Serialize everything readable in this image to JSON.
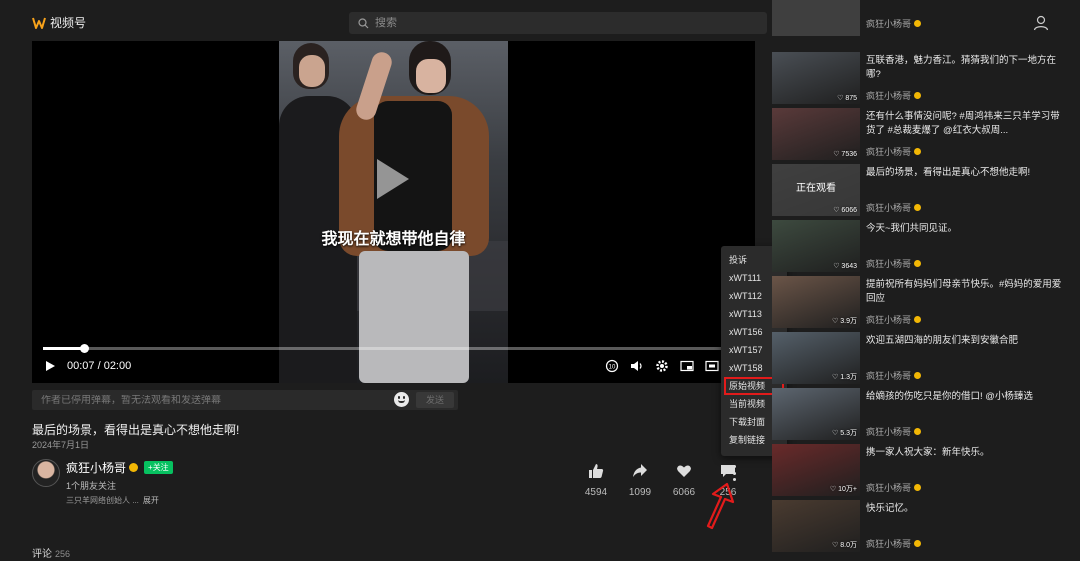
{
  "header": {
    "logo_text": "视频号",
    "search_placeholder": "搜索"
  },
  "player": {
    "subtitle": "我现在就想带他自律",
    "current_time": "00:07",
    "duration": "02:00",
    "time_display": "00:07 / 02:00",
    "progress_fraction": 0.058
  },
  "danmaku": {
    "placeholder": "作者已停用弹幕，暂无法观看和发送弹幕",
    "send_label": "发送"
  },
  "video": {
    "title": "最后的场景，看得出是真心不想他走啊!",
    "date": "2024年7月1日"
  },
  "author": {
    "name": "疯狂小杨哥",
    "follow_label": "+关注",
    "friends": "1个朋友关注",
    "bio": "三只羊网络创始人 ...",
    "expand": "展开"
  },
  "actions": {
    "like": "4594",
    "share": "1099",
    "heart": "6066",
    "comment": "256"
  },
  "comments": {
    "label": "评论",
    "count": "256"
  },
  "menu": {
    "items": [
      "投诉",
      "xWT111",
      "xWT112",
      "xWT113",
      "xWT156",
      "xWT157",
      "xWT158",
      "原始视频",
      "当前视频",
      "下载封面",
      "复制链接"
    ]
  },
  "sidebar": {
    "items": [
      {
        "title": "互联香港，魅力香江。猜猜我们的下一地方在哪?",
        "author": "疯狂小杨哥",
        "likes": "875",
        "thumb": "#4a4f55"
      },
      {
        "title": "还有什么事情没问呢? #周鸿祎来三只羊学习带货了 #总裁麦爆了 @红衣大叔周...",
        "author": "疯狂小杨哥",
        "likes": "7536",
        "thumb": "#5a3a3a"
      },
      {
        "title": "最后的场景，看得出是真心不想他走啊!",
        "author": "疯狂小杨哥",
        "likes": "6066",
        "watching": "正在观看",
        "thumb": "#555"
      },
      {
        "title": "今天~我们共同见证。",
        "author": "疯狂小杨哥",
        "likes": "3643",
        "thumb": "#3d4a3f"
      },
      {
        "title": "提前祝所有妈妈们母亲节快乐。#妈妈的爱用爱回应",
        "author": "疯狂小杨哥",
        "likes": "3.9万",
        "thumb": "#6b5548"
      },
      {
        "title": "欢迎五湖四海的朋友们来到安徽合肥",
        "author": "疯狂小杨哥",
        "likes": "1.3万",
        "thumb": "#55606a"
      },
      {
        "title": "给嫡孩的伤吃只是你的借口! @小杨臻选",
        "author": "疯狂小杨哥",
        "likes": "5.3万",
        "thumb": "#5d6670"
      },
      {
        "title": "携一家人祝大家：新年快乐。",
        "author": "疯狂小杨哥",
        "likes": "10万+",
        "thumb": "#6a2a2a"
      },
      {
        "title": "快乐记忆。",
        "author": "疯狂小杨哥",
        "likes": "8.0万",
        "thumb": "#4a3b30"
      }
    ]
  }
}
